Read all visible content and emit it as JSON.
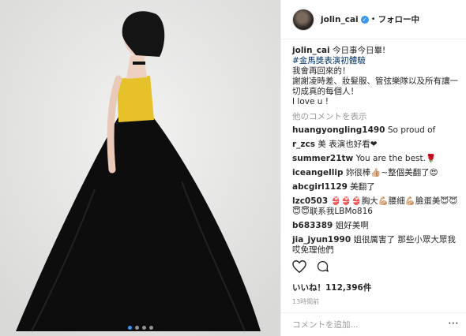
{
  "post": {
    "photo_dots": 4,
    "active_dot": 1
  },
  "header": {
    "username": "jolin_cai",
    "dot": "•",
    "follow_label": "フォロー中"
  },
  "caption": {
    "user": "jolin_cai",
    "line1": "今日事今日畢!",
    "line2": "#金馬獎表演初體驗",
    "line3": "我會再回來的！",
    "line4": "謝謝凌時差、妝髮服、管弦樂隊以及所有讓一切成真的每個人！",
    "line5": "I love u !"
  },
  "load_more": "他のコメントを表示",
  "comments": [
    {
      "user": "huangyongling1490",
      "text": "So proud of"
    },
    {
      "user": "r_zcs",
      "text": "美 表演也好看❤"
    },
    {
      "user": "summer21tw",
      "text": "You are the best.🌹"
    },
    {
      "user": "iceangellip",
      "text": "妳很棒👍🏼~整個美翻了😍"
    },
    {
      "user": "abcgirl1129",
      "text": "美翻了"
    },
    {
      "user": "lzc0503",
      "text": "👙👙👙胸大💪🏼腰細💪🏼臉蛋美😇😇😇😇联系我LBMo816"
    },
    {
      "user": "b683389",
      "text": "姐好美啊"
    },
    {
      "user": "jia_jyun1990",
      "text": "姐很厲害了 那些小眾大眾我哎免理他們"
    }
  ],
  "likes": "いいね！112,396件",
  "time": "13時間前",
  "add_comment_placeholder": "コメントを追加...",
  "more_options": "⋯"
}
